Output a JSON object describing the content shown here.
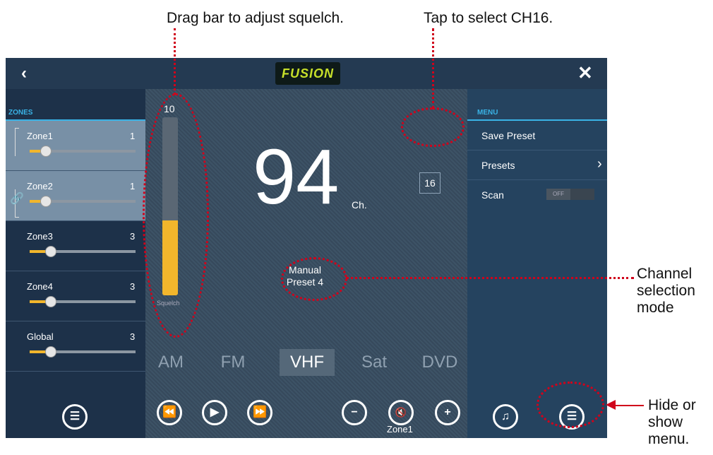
{
  "annotations": {
    "squelch": "Drag bar to adjust squelch.",
    "ch16": "Tap to select  CH16.",
    "mode_l1": "Channel",
    "mode_l2": "selection",
    "mode_l3": "mode",
    "menu_l1": "Hide or",
    "menu_l2": "show",
    "menu_l3": "menu."
  },
  "topbar": {
    "back": "‹",
    "logo": "FUSION",
    "close": "✕"
  },
  "zones": {
    "heading": "ZONES",
    "items": [
      {
        "name": "Zone1",
        "value": "1",
        "level": 0.15
      },
      {
        "name": "Zone2",
        "value": "1",
        "level": 0.15
      },
      {
        "name": "Zone3",
        "value": "3",
        "level": 0.2
      },
      {
        "name": "Zone4",
        "value": "3",
        "level": 0.2
      },
      {
        "name": "Global",
        "value": "3",
        "level": 0.2
      }
    ]
  },
  "squelch": {
    "top_value": "10",
    "label": "Squelch",
    "level": 0.42
  },
  "channel": {
    "ch16": "16",
    "number": "94",
    "unit": "Ch.",
    "mode_l1": "Manual",
    "mode_l2": "Preset 4"
  },
  "bands": [
    "AM",
    "FM",
    "VHF",
    "Sat",
    "DVD"
  ],
  "active_band": "VHF",
  "transport": {
    "zone_label": "Zone1"
  },
  "menu": {
    "heading": "MENU",
    "save_preset": "Save Preset",
    "presets": "Presets",
    "scan": "Scan",
    "scan_state": "OFF"
  },
  "colors": {
    "accent": "#3ab3e6",
    "slider": "#f2b62c",
    "highlight": "#d0021b"
  }
}
